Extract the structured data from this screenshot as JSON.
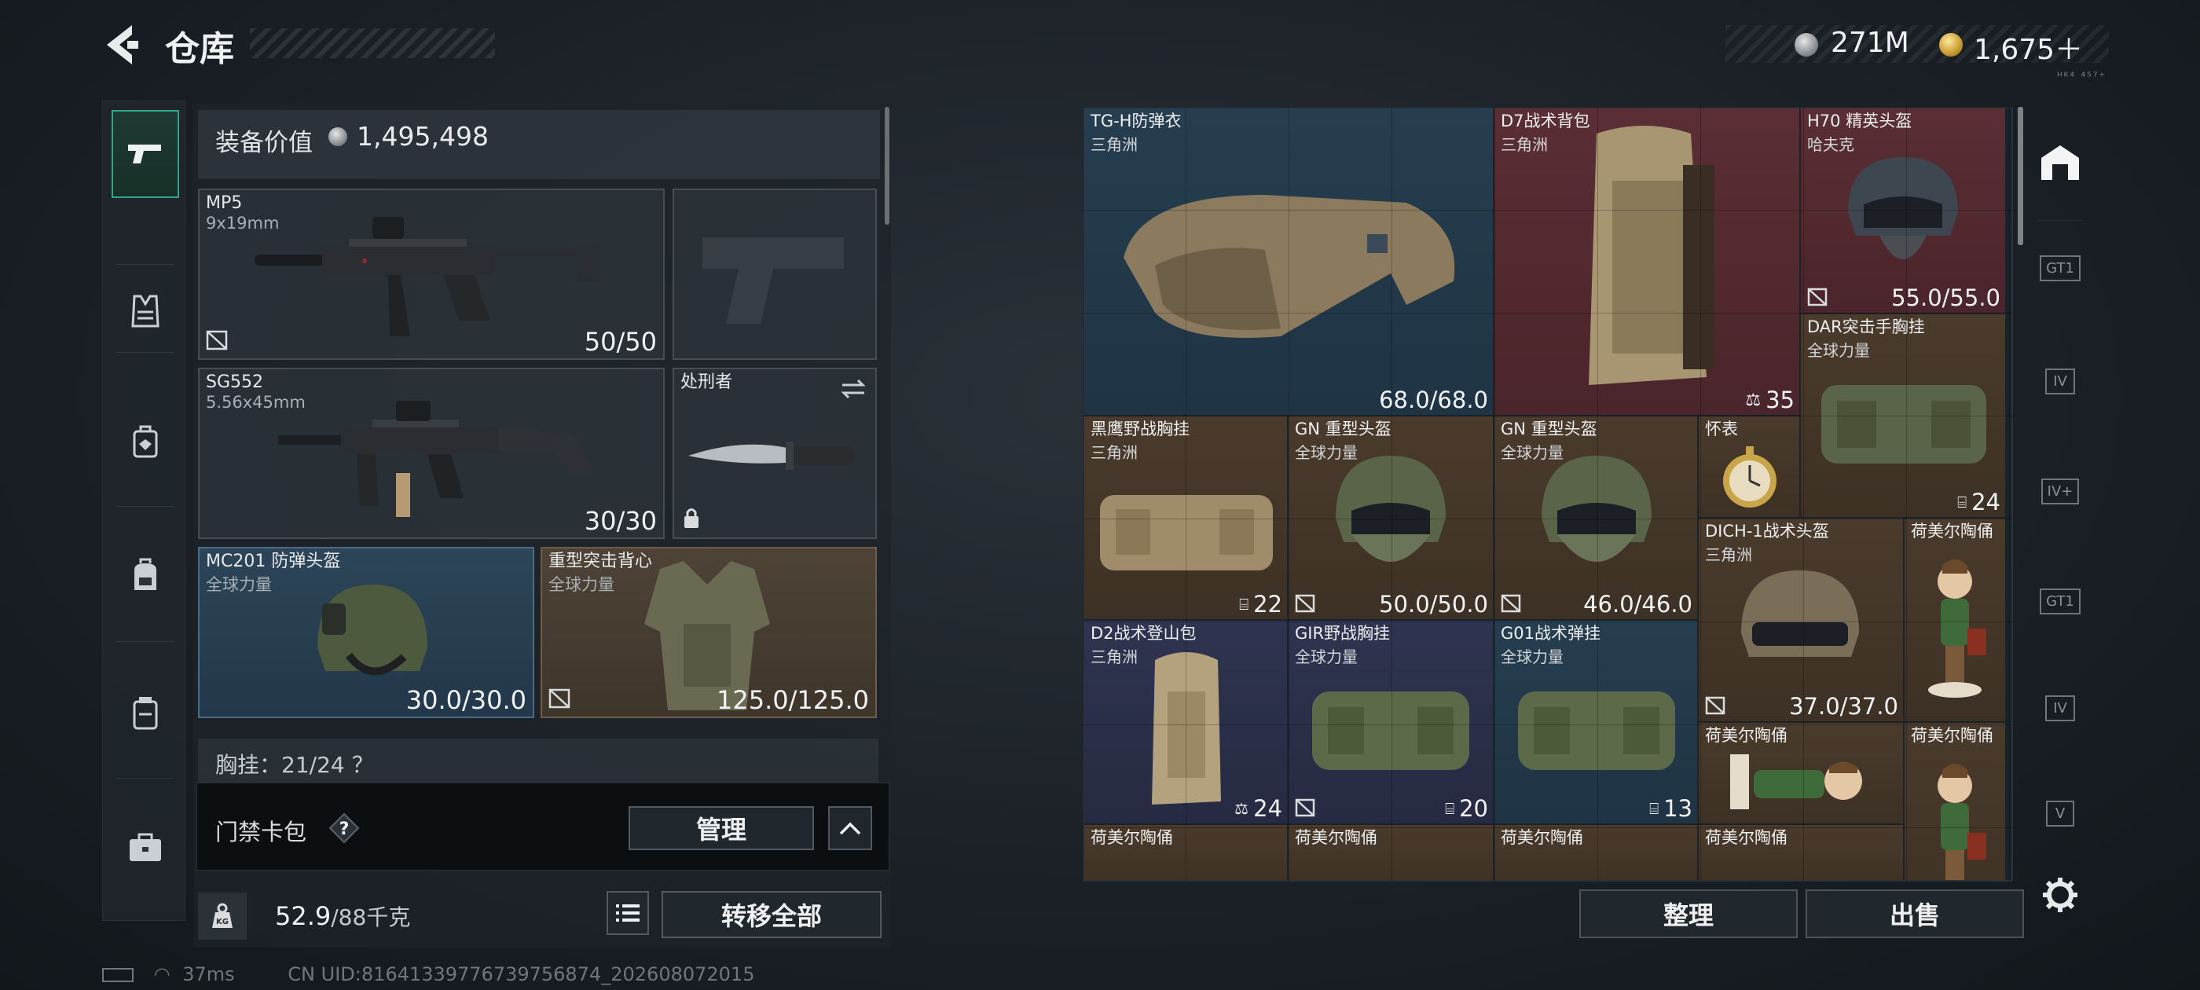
{
  "header": {
    "title": "仓库",
    "silver": "271M",
    "gold": "1,675＋",
    "version": "ᴴᴷ⁴ ⁴⁵⁷⁺"
  },
  "loadout": {
    "value_label": "装备价值",
    "value_amount": "1,495,498",
    "slots": [
      {
        "name": "MP5",
        "sub": "9x19mm",
        "durability": "50/50",
        "tier": "gray"
      },
      {
        "name": "",
        "sub": "",
        "durability": "",
        "tier": "empty-pistol"
      },
      {
        "name": "SG552",
        "sub": "5.56x45mm",
        "durability": "30/30",
        "tier": "gray"
      },
      {
        "name": "处刑者",
        "sub": "",
        "durability": "",
        "tier": "gray"
      },
      {
        "name": "MC201 防弹头盔",
        "sub": "全球力量",
        "durability": "30.0/30.0",
        "tier": "blue"
      },
      {
        "name": "重型突击背心",
        "sub": "全球力量",
        "durability": "125.0/125.0",
        "tier": "brown"
      }
    ],
    "partial_row": "胸挂：21/24 ？",
    "card_pack_label": "门禁卡包",
    "manage_label": "管理",
    "weight": "52.9",
    "weight_max": "/88千克",
    "transfer_all_label": "转移全部"
  },
  "status": {
    "ping": "37ms",
    "uid": "CN UID:8164133977673975687​4_202608072015"
  },
  "stash": {
    "items": [
      {
        "name": "TG-H防弹衣",
        "sub": "三角洲",
        "value": "68.0/68.0",
        "color": "blue"
      },
      {
        "name": "D7战术背包",
        "sub": "三角洲",
        "value": "35",
        "color": "red"
      },
      {
        "name": "H70 精英头盔",
        "sub": "哈夫克",
        "value": "55.0/55.0",
        "color": "red"
      },
      {
        "name": "DAR突击手胸挂",
        "sub": "全球力量",
        "value": "24",
        "color": "brown"
      },
      {
        "name": "黑鹰野战胸挂",
        "sub": "三角洲",
        "value": "22",
        "color": "brown"
      },
      {
        "name": "GN 重型头盔",
        "sub": "全球力量",
        "value": "50.0/50.0",
        "color": "brown"
      },
      {
        "name": "GN 重型头盔",
        "sub": "全球力量",
        "value": "46.0/46.0",
        "color": "brown"
      },
      {
        "name": "怀表",
        "sub": "",
        "value": "",
        "color": "brown"
      },
      {
        "name": "DICH-1战术头盔",
        "sub": "三角洲",
        "value": "37.0/37.0",
        "color": "brown"
      },
      {
        "name": "荷美尔陶俑",
        "sub": "",
        "value": "",
        "color": "brown"
      },
      {
        "name": "D2战术登山包",
        "sub": "三角洲",
        "value": "24",
        "color": "navy"
      },
      {
        "name": "GIR野战胸挂",
        "sub": "全球力量",
        "value": "20",
        "color": "navy"
      },
      {
        "name": "G01战术弹挂",
        "sub": "全球力量",
        "value": "13",
        "color": "blue"
      },
      {
        "name": "荷美尔陶俑",
        "sub": "",
        "value": "",
        "color": "brown"
      },
      {
        "name": "荷美尔陶俑",
        "sub": "",
        "value": "",
        "color": "brown"
      },
      {
        "name": "荷美尔陶俑",
        "sub": "",
        "value": "",
        "color": "brown"
      },
      {
        "name": "荷美尔陶俑",
        "sub": "",
        "value": "",
        "color": "brown"
      },
      {
        "name": "荷美尔陶俑",
        "sub": "",
        "value": "",
        "color": "brown"
      },
      {
        "name": "荷美尔陶俑",
        "sub": "",
        "value": "",
        "color": "brown"
      }
    ],
    "sort_label": "整理",
    "sell_label": "出售"
  },
  "right_rail": [
    "GT1",
    "IV",
    "IV+",
    "GT1",
    "IV",
    "V"
  ],
  "colors": {
    "accent": "#2fa58a",
    "blue": "#263e50",
    "red": "#5a2e34",
    "brown": "#4a3b2c",
    "navy": "#2f3450"
  }
}
